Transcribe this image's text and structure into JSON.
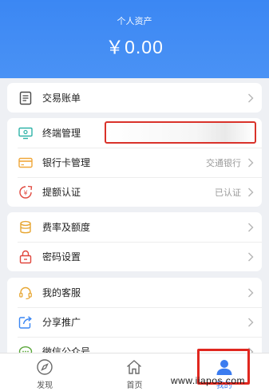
{
  "header": {
    "label": "个人资产",
    "amount": "￥0.00"
  },
  "sections": {
    "bill": {
      "label": "交易账单"
    },
    "terminal": {
      "label": "终端管理",
      "value": ""
    },
    "bankcard": {
      "label": "银行卡管理",
      "value": "交通银行"
    },
    "withdraw_auth": {
      "label": "提额认证",
      "value": "已认证"
    },
    "rates": {
      "label": "费率及额度"
    },
    "password": {
      "label": "密码设置"
    },
    "service": {
      "label": "我的客服"
    },
    "share": {
      "label": "分享推广"
    },
    "wechat": {
      "label": "微信公众号"
    }
  },
  "tabbar": {
    "discover": "发现",
    "home": "首页",
    "mine": "我的"
  },
  "watermark": "www.iiapos.com",
  "colors": {
    "primary": "#3b87f3",
    "highlight": "#e0271f"
  },
  "icons": {
    "bill": "document-icon",
    "terminal": "monitor-icon",
    "bankcard": "card-icon",
    "withdraw_auth": "yuan-badge-icon",
    "rates": "coin-stack-icon",
    "password": "lock-icon",
    "service": "headset-icon",
    "share": "share-arrow-icon",
    "wechat": "chat-bubble-icon",
    "discover": "compass-icon",
    "home": "home-icon",
    "mine": "user-icon"
  }
}
